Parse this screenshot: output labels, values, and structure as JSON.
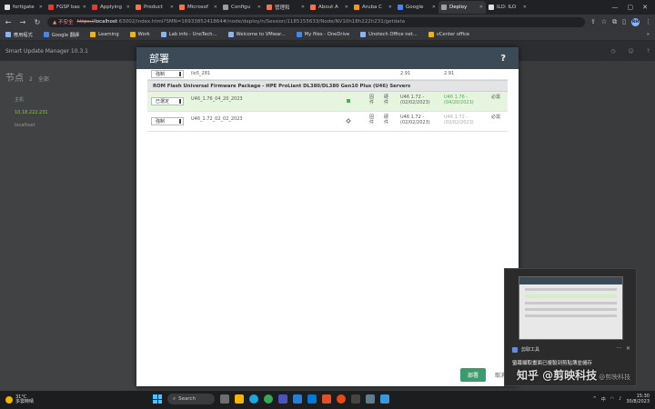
{
  "browser": {
    "tabs": [
      {
        "label": "fortigate",
        "color": "#e0e0e0"
      },
      {
        "label": "FGSP bas",
        "color": "#e53935"
      },
      {
        "label": "Applying",
        "color": "#e53935"
      },
      {
        "label": "Product",
        "color": "#ff7043"
      },
      {
        "label": "Microsof",
        "color": "#ff7043"
      },
      {
        "label": "Configu",
        "color": "#9e9e9e"
      },
      {
        "label": "管理和",
        "color": "#ff7043"
      },
      {
        "label": "About A",
        "color": "#ff7043"
      },
      {
        "label": "Aruba C",
        "color": "#ff9800"
      },
      {
        "label": "Google",
        "color": "#4285f4"
      },
      {
        "label": "Deploy",
        "color": "#9e9e9e",
        "active": true
      },
      {
        "label": "ILO: ILO",
        "color": "#e0e0e0"
      }
    ],
    "url": {
      "warning": "▲ 不安全",
      "scheme": "https://",
      "host": "localhost",
      "path": ":63002/index.html?SMN=1693385241864#/node/deploy/n/Session/1185155633/Node/NV10h18h222h231/getdata"
    },
    "bookmarks": [
      {
        "label": "應用程式",
        "color": "#8ab4f8"
      },
      {
        "label": "Google 翻譯",
        "color": "#4285f4"
      },
      {
        "label": "Learning",
        "color": "#f4b400"
      },
      {
        "label": "Work",
        "color": "#f4b400"
      },
      {
        "label": "Lab info - UnoTech...",
        "color": "#8ab4f8"
      },
      {
        "label": "Welcome to VMwar...",
        "color": "#8ab4f8"
      },
      {
        "label": "My files - OneDrive",
        "color": "#4285f4"
      },
      {
        "label": "Unotech Office net...",
        "color": "#8ab4f8"
      },
      {
        "label": "vCenter office",
        "color": "#f4b400"
      }
    ],
    "profile_initials": "RH"
  },
  "app": {
    "title": "Smart Update Manager 10.3.1",
    "section_title": "节点",
    "section_count": "2",
    "filter_label": "全部",
    "tree": [
      "主机",
      "10.18.222.231",
      "localhost"
    ]
  },
  "modal": {
    "title": "部署",
    "help": "?",
    "rows_top": {
      "select": "強制",
      "version": "ilo5_281",
      "installed": "2.91",
      "available": "2.91"
    },
    "group": "ROM Flash Universal Firmware Package - HPE ProLiant DL380/DL380 Gen10 Plus (U46) Servers",
    "rows": [
      {
        "select": "已選定",
        "name": "U46_1.76_04_20_2023",
        "type": "固件",
        "kind": "硬件",
        "installed": "U46 1.72 - (02/02/2023)",
        "available": "U46 1.76 - (04/20/2023)",
        "action": "必需"
      },
      {
        "select": "強制",
        "name": "U46_1.72_02_02_2023",
        "type": "固件",
        "kind": "硬件",
        "installed": "U46 1.72 - (02/02/2023)",
        "available": "U46 1.72 - (02/02/2023)",
        "action": "必需"
      }
    ],
    "deploy_button": "部署",
    "cancel_button": "取消"
  },
  "notification": {
    "app_name": "剪取工具",
    "message": "螢幕擷取畫面已複製到剪貼簿並儲存"
  },
  "watermark": {
    "main": "知乎 @剪映科技",
    "sub": "@剪映科技"
  },
  "taskbar": {
    "temperature": "31°C",
    "weather": "多雲時晴",
    "search": "Search",
    "time": "15:30",
    "date": "30/8/2023",
    "lang": "中"
  }
}
